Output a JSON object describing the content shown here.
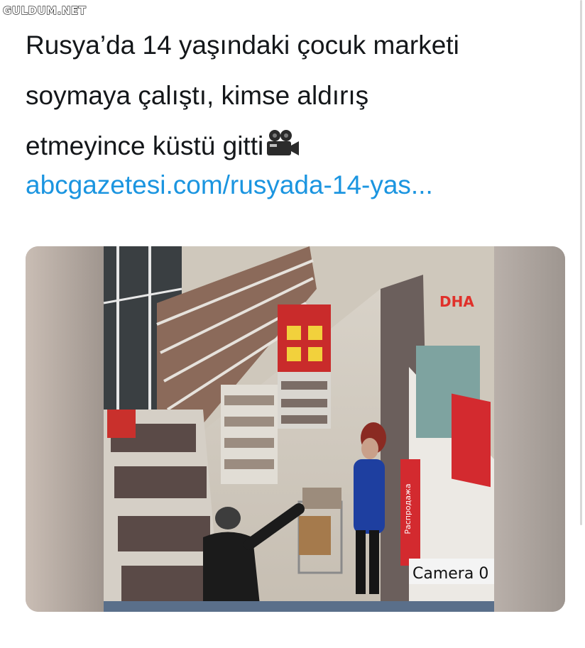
{
  "watermark": "GULDUM.NET",
  "tweet": {
    "text_lines": [
      "Rusya’da 14 yaşındaki çocuk marketi",
      "soymaya çalıştı, kimse aldırış",
      "etmeyince küstü gitti"
    ],
    "emoji_icon": "video-camera-icon",
    "link": "abcgazetesi.com/rusyada-14-yas..."
  },
  "media": {
    "broadcaster_logo": "DHA",
    "camera_label": "Camera 0",
    "sign_text": "Распродажа"
  },
  "colors": {
    "text": "#14171a",
    "link": "#1b95e0",
    "sign_red": "#d32a2f"
  }
}
